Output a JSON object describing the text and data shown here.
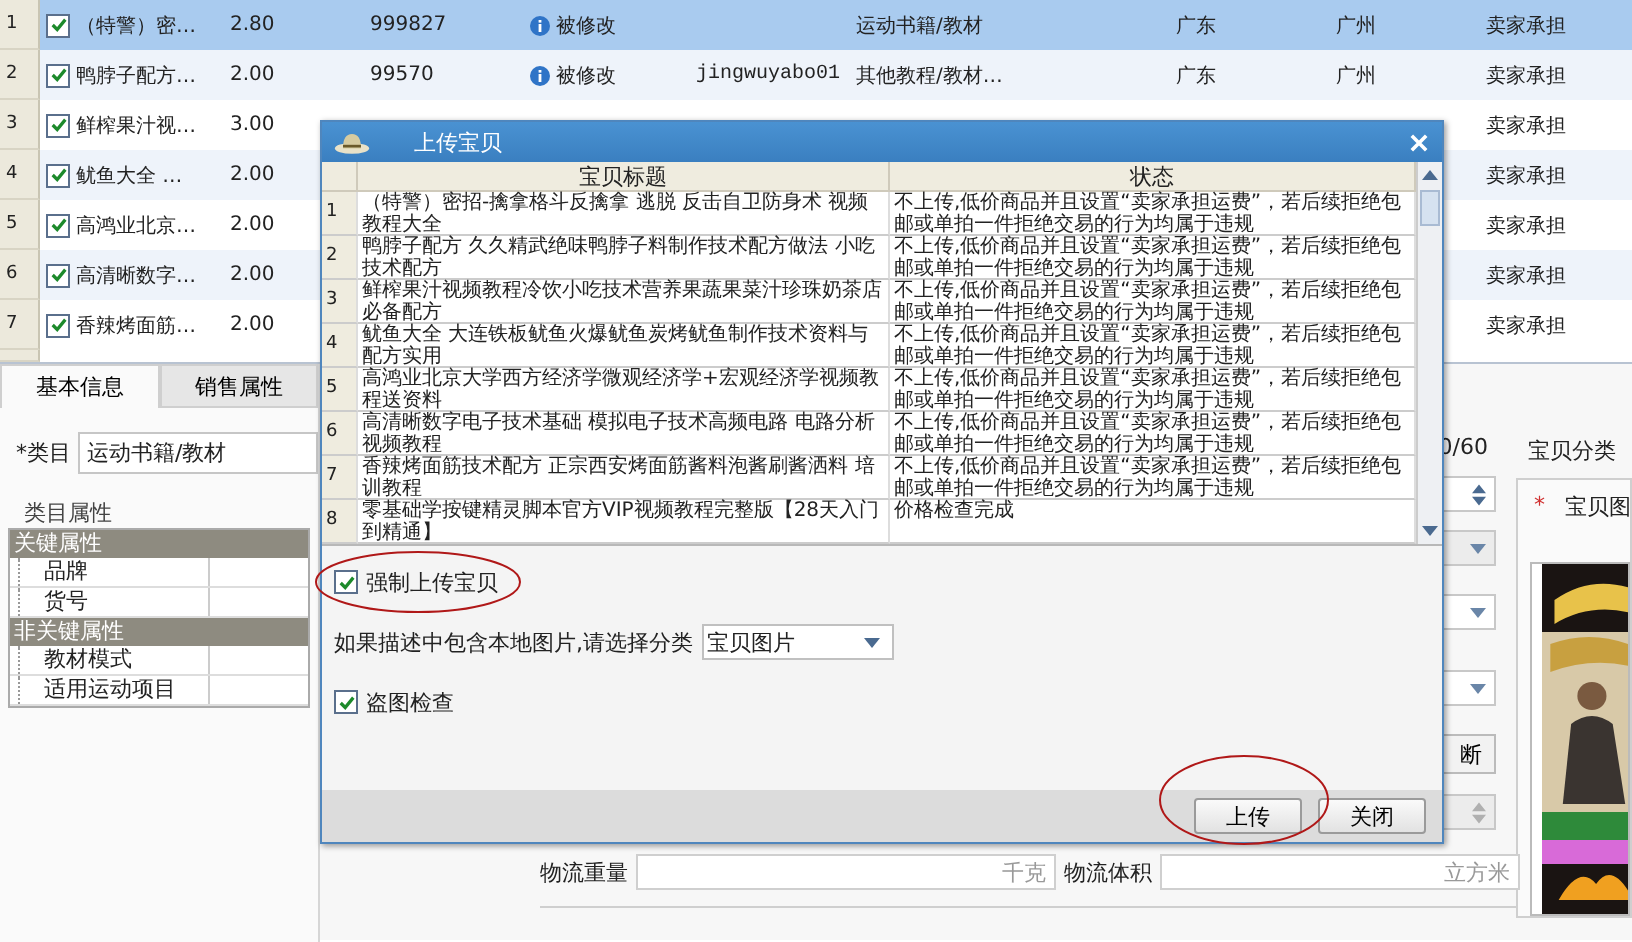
{
  "product_table": {
    "rows": [
      {
        "index": "1",
        "checked": true,
        "selected": true,
        "title": "（特警）密…",
        "price": "2.80",
        "id": "999827",
        "status": "被修改",
        "category": "运动书籍/教材",
        "province": "广东",
        "city": "广州",
        "shipping": "卖家承担"
      },
      {
        "index": "2",
        "checked": true,
        "selected": false,
        "title": "鸭脖子配方…",
        "price": "2.00",
        "id": "99570",
        "status": "被修改",
        "seller": "jingwuyabo01",
        "category": "其他教程/教材…",
        "province": "广东",
        "city": "广州",
        "shipping": "卖家承担"
      },
      {
        "index": "3",
        "checked": true,
        "selected": false,
        "title": "鲜榨果汁视…",
        "price": "3.00",
        "shipping": "卖家承担"
      },
      {
        "index": "4",
        "checked": true,
        "selected": false,
        "title": "鱿鱼大全 …",
        "price": "2.00",
        "shipping": "卖家承担"
      },
      {
        "index": "5",
        "checked": true,
        "selected": false,
        "title": "高鸿业北京…",
        "price": "2.00",
        "shipping": "卖家承担"
      },
      {
        "index": "6",
        "checked": true,
        "selected": false,
        "title": "高清晰数字…",
        "price": "2.00",
        "shipping": "卖家承担"
      },
      {
        "index": "7",
        "checked": true,
        "selected": false,
        "title": "香辣烤面筋…",
        "price": "2.00",
        "shipping": "卖家承担"
      }
    ]
  },
  "editor": {
    "tabs": [
      {
        "label": "基本信息",
        "selected": true
      },
      {
        "label": "销售属性",
        "selected": false
      }
    ],
    "category": {
      "label": "*类目",
      "value": "运动书籍/教材"
    },
    "attributes": {
      "title": "类目属性",
      "groups": [
        {
          "name": "关键属性",
          "items": [
            "品牌",
            "货号"
          ]
        },
        {
          "name": "非关键属性",
          "items": [
            "教材模式",
            "适用运动项目"
          ]
        }
      ]
    },
    "title_count": "0/60",
    "side_button": "断",
    "weight": {
      "label": "物流重量",
      "unit": "千克"
    },
    "volume": {
      "label": "物流体积",
      "unit": "立方米"
    },
    "shop_category": "宝贝分类",
    "image": {
      "label": "宝贝图",
      "required_mark": "*",
      "kind": "picture"
    }
  },
  "dialog": {
    "title": "上传宝贝",
    "columns": [
      "宝贝标题",
      "状态"
    ],
    "rows": [
      {
        "index": "1",
        "title": "（特警）密招-擒拿格斗反擒拿 逃脱 反击自卫防身术 视频教程大全",
        "status": "不上传,低价商品并且设置“卖家承担运费”，若后续拒绝包邮或单拍一件拒绝交易的行为均属于违规"
      },
      {
        "index": "2",
        "title": "鸭脖子配方 久久精武绝味鸭脖子料制作技术配方做法 小吃技术配方",
        "status": "不上传,低价商品并且设置“卖家承担运费”，若后续拒绝包邮或单拍一件拒绝交易的行为均属于违规"
      },
      {
        "index": "3",
        "title": "鲜榨果汁视频教程冷饮小吃技术营养果蔬果菜汁珍珠奶茶店必备配方",
        "status": "不上传,低价商品并且设置“卖家承担运费”，若后续拒绝包邮或单拍一件拒绝交易的行为均属于违规"
      },
      {
        "index": "4",
        "title": "鱿鱼大全 大连铁板鱿鱼火爆鱿鱼炭烤鱿鱼制作技术资料与配方实用",
        "status": "不上传,低价商品并且设置“卖家承担运费”，若后续拒绝包邮或单拍一件拒绝交易的行为均属于违规"
      },
      {
        "index": "5",
        "title": "高鸿业北京大学西方经济学微观经济学+宏观经济学视频教程送资料",
        "status": "不上传,低价商品并且设置“卖家承担运费”，若后续拒绝包邮或单拍一件拒绝交易的行为均属于违规"
      },
      {
        "index": "6",
        "title": "高清晰数字电子技术基础 模拟电子技术高频电路 电路分析视频教程",
        "status": "不上传,低价商品并且设置“卖家承担运费”，若后续拒绝包邮或单拍一件拒绝交易的行为均属于违规"
      },
      {
        "index": "7",
        "title": "香辣烤面筋技术配方 正宗西安烤面筋酱料泡酱刷酱洒料 培训教程",
        "status": "不上传,低价商品并且设置“卖家承担运费”，若后续拒绝包邮或单拍一件拒绝交易的行为均属于违规"
      },
      {
        "index": "8",
        "title": "零基础学按键精灵脚本官方VIP视频教程完整版【28天入门到精通】",
        "status": "价格检查完成"
      }
    ],
    "force_upload": {
      "label": "强制上传宝贝",
      "checked": true
    },
    "image_category": {
      "label": "如果描述中包含本地图片,请选择分类",
      "value": "宝贝图片"
    },
    "theft_check": {
      "label": "盗图检查",
      "checked": true
    },
    "buttons": [
      "上传",
      "关闭"
    ]
  }
}
